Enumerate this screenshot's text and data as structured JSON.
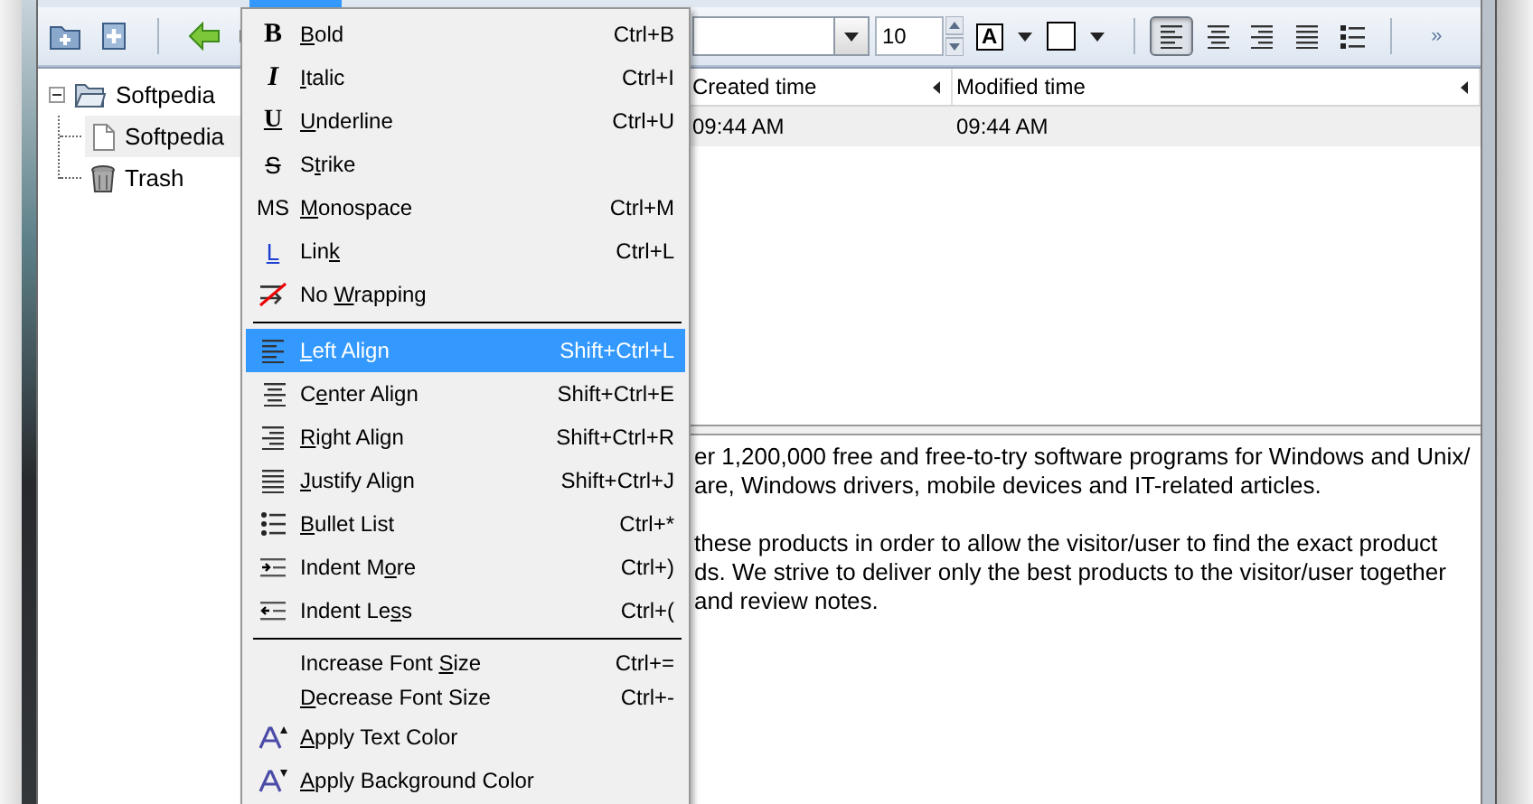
{
  "toolbar": {
    "font_size": "10",
    "text_color_glyph": "A",
    "chevron": "»",
    "align_buttons": [
      {
        "selected": true
      },
      {
        "selected": false
      },
      {
        "selected": false
      },
      {
        "selected": false
      }
    ]
  },
  "menu": {
    "items": [
      {
        "kind": "item",
        "glyph": "B",
        "label": "Bold",
        "shortcut": "Ctrl+B",
        "selected": false
      },
      {
        "kind": "item",
        "glyph": "I",
        "label": "Italic",
        "shortcut": "Ctrl+I",
        "selected": false
      },
      {
        "kind": "item",
        "glyph": "U",
        "label": "Underline",
        "shortcut": "Ctrl+U",
        "selected": false
      },
      {
        "kind": "item",
        "glyph": "S",
        "label": "Strike",
        "selected": false
      },
      {
        "kind": "item",
        "glyph": "MS",
        "label": "Monospace",
        "shortcut": "Ctrl+M",
        "selected": false
      },
      {
        "kind": "item",
        "glyph": "L",
        "label": "Link",
        "shortcut": "Ctrl+L",
        "selected": false
      },
      {
        "kind": "item",
        "label": "No Wrapping",
        "selected": false
      },
      {
        "kind": "separator"
      },
      {
        "kind": "item",
        "label": "Left Align",
        "shortcut": "Shift+Ctrl+L",
        "selected": true
      },
      {
        "kind": "item",
        "label": "Center Align",
        "shortcut": "Shift+Ctrl+E",
        "selected": false
      },
      {
        "kind": "item",
        "label": "Right Align",
        "shortcut": "Shift+Ctrl+R",
        "selected": false
      },
      {
        "kind": "item",
        "label": "Justify Align",
        "shortcut": "Shift+Ctrl+J",
        "selected": false
      },
      {
        "kind": "item",
        "label": "Bullet List",
        "shortcut": "Ctrl+*",
        "selected": false
      },
      {
        "kind": "item",
        "label": "Indent More",
        "shortcut": "Ctrl+)",
        "selected": false
      },
      {
        "kind": "item",
        "label": "Indent Less",
        "shortcut": "Ctrl+(",
        "selected": false
      },
      {
        "kind": "separator"
      },
      {
        "kind": "item",
        "label": "Increase Font Size",
        "shortcut": "Ctrl+=",
        "selected": false
      },
      {
        "kind": "item",
        "label": "Decrease Font Size",
        "shortcut": "Ctrl+-",
        "selected": false
      },
      {
        "kind": "item",
        "label": "Apply Text Color",
        "selected": false
      },
      {
        "kind": "item",
        "label": "Apply Background Color",
        "selected": false
      }
    ]
  },
  "tree": {
    "items": [
      {
        "label": "Softpedia",
        "expanded": true,
        "selected": false,
        "children": [
          {
            "label": "Softpedia",
            "selected": true
          },
          {
            "label": "Trash",
            "selected": false
          }
        ]
      }
    ]
  },
  "list": {
    "columns": [
      "Created time",
      "Modified time"
    ],
    "rows": [
      {
        "cells": [
          "09:44 AM",
          "09:44 AM"
        ],
        "selected": true
      }
    ]
  },
  "editor": {
    "paragraphs": [
      {
        "lines": [
          "er 1,200,000 free and free-to-try software programs for Windows and Unix/",
          "are, Windows drivers, mobile devices and IT-related articles."
        ]
      },
      {
        "lines": [
          "these products in order to allow the visitor/user to find the exact product",
          "ds. We strive to deliver only the best products to the visitor/user together",
          "and review notes."
        ]
      }
    ]
  }
}
